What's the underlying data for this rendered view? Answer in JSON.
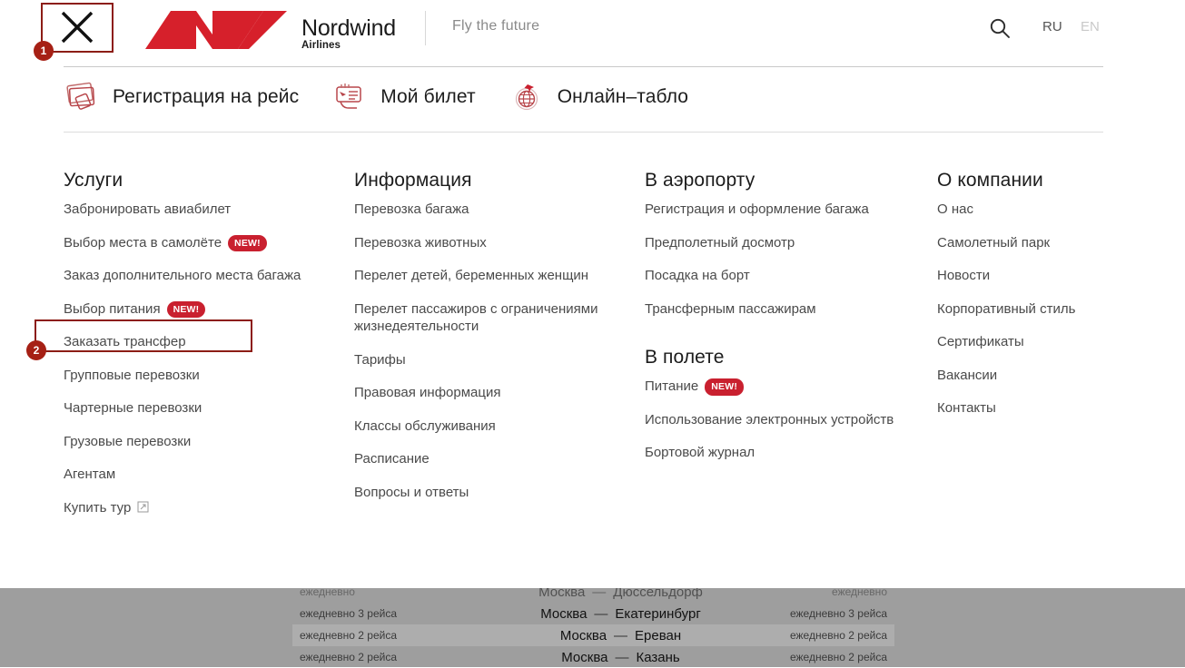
{
  "header": {
    "close_icon": "close-x-icon",
    "brand": {
      "name": "Nordwind",
      "sub": "Airlines",
      "logo_color": "#D6202B"
    },
    "tagline": "Fly the future",
    "search_icon": "search-icon",
    "lang_active": "RU",
    "lang_inactive": "EN"
  },
  "quicknav": [
    {
      "label": "Регистрация на рейс",
      "icon": "boarding-pass-icon"
    },
    {
      "label": "Мой билет",
      "icon": "ticket-hand-icon"
    },
    {
      "label": "Онлайн–табло",
      "icon": "globe-plane-icon"
    }
  ],
  "columns": [
    {
      "heading": "Услуги",
      "links": [
        {
          "label": "Забронировать авиабилет"
        },
        {
          "label": "Выбор места в самолёте",
          "badge": "NEW!"
        },
        {
          "label": "Заказ дополнительного места багажа"
        },
        {
          "label": "Выбор питания",
          "badge": "NEW!"
        },
        {
          "label": "Заказать трансфер"
        },
        {
          "label": "Групповые перевозки"
        },
        {
          "label": "Чартерные перевозки"
        },
        {
          "label": "Грузовые перевозки"
        },
        {
          "label": "Агентам"
        },
        {
          "label": "Купить тур",
          "external": true
        }
      ]
    },
    {
      "heading": "Информация",
      "links": [
        {
          "label": "Перевозка багажа"
        },
        {
          "label": "Перевозка животных"
        },
        {
          "label": "Перелет детей, беременных женщин"
        },
        {
          "label": "Перелет пассажиров с ограничениями жизнедеятельности"
        },
        {
          "label": "Тарифы"
        },
        {
          "label": "Правовая информация"
        },
        {
          "label": "Классы обслуживания"
        },
        {
          "label": "Расписание"
        },
        {
          "label": "Вопросы и ответы"
        }
      ]
    },
    {
      "heading": "В аэропорту",
      "links": [
        {
          "label": "Регистрация и оформление багажа"
        },
        {
          "label": "Предполетный досмотр"
        },
        {
          "label": "Посадка на борт"
        },
        {
          "label": "Трансферным пассажирам"
        }
      ],
      "heading2": "В полете",
      "links2": [
        {
          "label": "Питание",
          "badge": "NEW!"
        },
        {
          "label": "Использование электронных устройств"
        },
        {
          "label": "Бортовой журнал"
        }
      ]
    },
    {
      "heading": "О компании",
      "links": [
        {
          "label": "О нас"
        },
        {
          "label": "Самолетный парк"
        },
        {
          "label": "Новости"
        },
        {
          "label": "Корпоративный стиль"
        },
        {
          "label": "Сертификаты"
        },
        {
          "label": "Вакансии"
        },
        {
          "label": "Контакты"
        }
      ]
    }
  ],
  "annotations": [
    {
      "number": "1",
      "target": "close-button"
    },
    {
      "number": "2",
      "target": "vybor-pitaniya-link"
    }
  ],
  "background_table": {
    "rows": [
      {
        "left": "ежедневно",
        "from": "Москва",
        "to": "Дюссельдорф",
        "right": "ежедневно",
        "clipped": true,
        "alt": false
      },
      {
        "left": "ежедневно 3 рейса",
        "from": "Москва",
        "to": "Екатеринбург",
        "right": "ежедневно 3 рейса",
        "clipped": false,
        "alt": false
      },
      {
        "left": "ежедневно 2 рейса",
        "from": "Москва",
        "to": "Ереван",
        "right": "ежедневно 2 рейса",
        "clipped": false,
        "alt": true
      },
      {
        "left": "ежедневно 2 рейса",
        "from": "Москва",
        "to": "Казань",
        "right": "ежедневно 2 рейса",
        "clipped": false,
        "alt": false
      }
    ],
    "dash": "—"
  }
}
